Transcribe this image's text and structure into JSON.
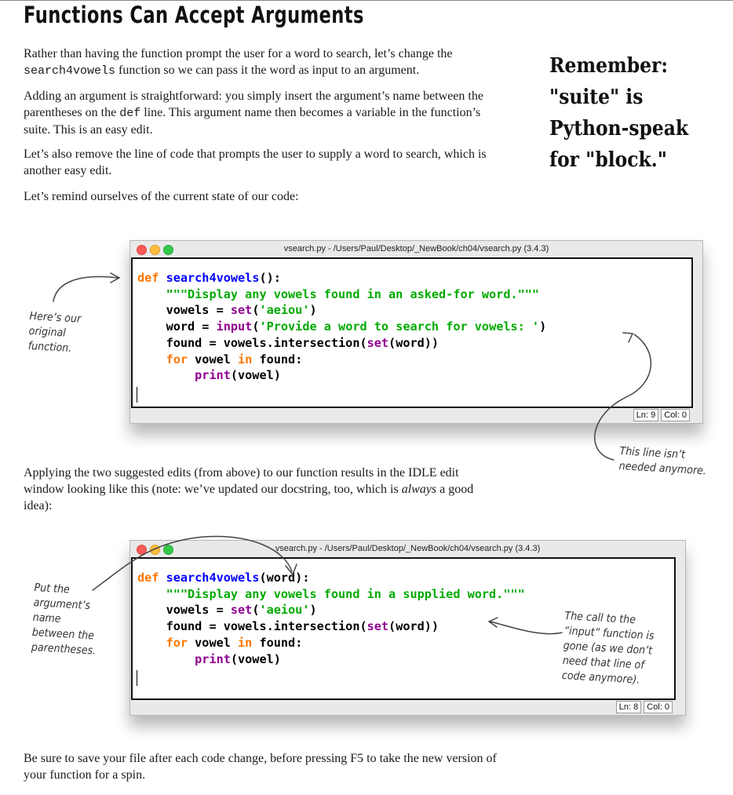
{
  "heading": "Functions Can Accept Arguments",
  "paragraphs": {
    "p1": {
      "a": "Rather than having the function prompt the user for a word to search, let’s change the ",
      "code": "search4vowels",
      "b": " function so we can pass it the word as input to an argument."
    },
    "p2": {
      "a": "Adding an argument is straightforward: you simply insert the argument’s name between the parentheses on the ",
      "code": "def",
      "b": " line. This argument name then becomes a variable in the function’s suite. This is an easy edit."
    },
    "p3": "Let’s also remove the line of code that prompts the user to supply a word to search, which is another easy edit.",
    "p4": "Let’s remind ourselves of the current state of our code:",
    "p5": {
      "a": "Applying the two suggested edits (from above) to our function results in the IDLE edit window looking like this (note: we’ve updated our docstring, too, which is ",
      "em": "always",
      "b": " a good idea):"
    },
    "p6": "Be sure to save your file after each code change, before pressing F5 to take the new version of your function for a spin."
  },
  "remember": {
    "line1": "Remember:",
    "line2": "\"suite\" is",
    "line3": "Python-speak",
    "line4": "for \"block.\""
  },
  "window1": {
    "title": "vsearch.py - /Users/Paul/Desktop/_NewBook/ch04/vsearch.py (3.4.3)",
    "status_ln": "Ln: 9",
    "status_col": "Col: 0",
    "code": {
      "def": "def",
      "fname": "search4vowels",
      "params": "():",
      "docstring": "\"\"\"Display any vowels found in an asked-for word.\"\"\"",
      "l2_var": "vowels = ",
      "l2_fn": "set",
      "l2_open": "(",
      "l2_str": "'aeiou'",
      "l2_close": ")",
      "l3_var": "word = ",
      "l3_fn": "input",
      "l3_open": "(",
      "l3_str": "'Provide a word to search for vowels: '",
      "l3_close": ")",
      "l4_var": "found = vowels.intersection(",
      "l4_fn": "set",
      "l4_rest": "(word))",
      "l5_for": "for",
      "l5_mid": " vowel ",
      "l5_in": "in",
      "l5_rest": " found:",
      "l6_fn": "print",
      "l6_rest": "(vowel)"
    }
  },
  "window2": {
    "title": "vsearch.py - /Users/Paul/Desktop/_NewBook/ch04/vsearch.py (3.4.3)",
    "status_ln": "Ln: 8",
    "status_col": "Col: 0",
    "code": {
      "def": "def",
      "fname": "search4vowels",
      "params": "(word):",
      "docstring": "\"\"\"Display any vowels found in a supplied word.\"\"\"",
      "l2_var": "vowels = ",
      "l2_fn": "set",
      "l2_open": "(",
      "l2_str": "'aeiou'",
      "l2_close": ")",
      "l3_var": "found = vowels.intersection(",
      "l3_fn": "set",
      "l3_rest": "(word))",
      "l4_for": "for",
      "l4_mid": " vowel ",
      "l4_in": "in",
      "l4_rest": " found:",
      "l5_fn": "print",
      "l5_rest": "(vowel)"
    }
  },
  "notes": {
    "original": [
      "Here’s our",
      "original",
      "function."
    ],
    "not_needed": [
      "This line isn’t",
      "needed anymore."
    ],
    "put_arg": [
      "Put the",
      "argument’s",
      "name",
      "between the",
      "parentheses."
    ],
    "input_gone": [
      "The call to the",
      "“input” function is",
      "gone (as we don’t",
      "need that line of",
      "code anymore)."
    ]
  }
}
